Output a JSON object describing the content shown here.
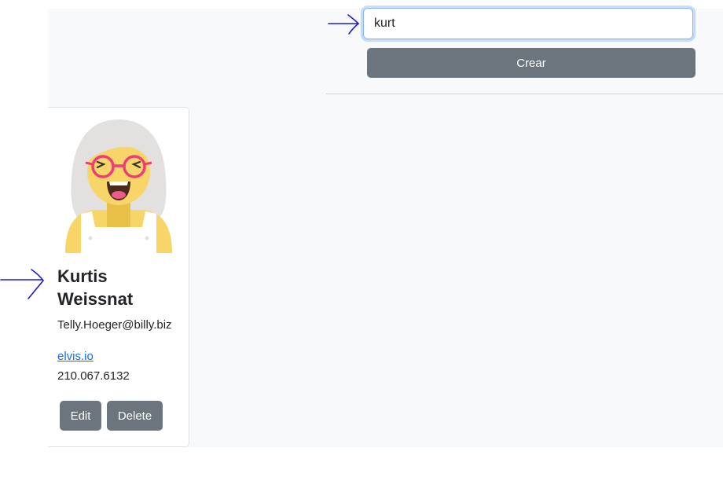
{
  "search": {
    "value": "kurt",
    "placeholder": ""
  },
  "actions": {
    "crear_label": "Crear"
  },
  "contact": {
    "first_name": "Kurtis",
    "last_name": "Weissnat",
    "email": "Telly.Hoeger@billy.biz",
    "website": "elvis.io",
    "phone": "210.067.6132",
    "edit_label": "Edit",
    "delete_label": "Delete"
  },
  "colors": {
    "button": "#6c757d",
    "link": "#0d6efd",
    "annotation": "#1a1ad6",
    "page_bg": "#f8f9fa"
  },
  "icons": {
    "avatar": "avatar-cartoon-woman",
    "annotation": "hand-drawn-arrow-icon"
  }
}
